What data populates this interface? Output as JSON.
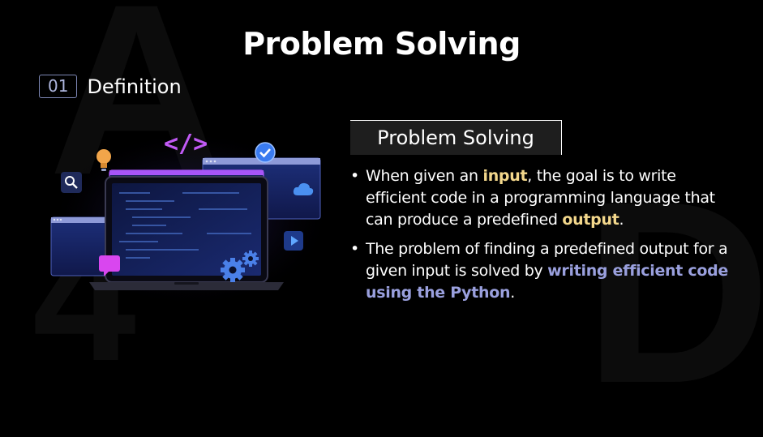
{
  "slide": {
    "title": "Problem Solving",
    "section_number": "01",
    "section_label": "Definition",
    "box_heading": "Problem Solving"
  },
  "bullets": [
    {
      "pre": "When given an ",
      "hl1": "input",
      "mid": ", the goal is to write efficient code in a programming language that can produce a predefined ",
      "hl2": "output",
      "post": "."
    },
    {
      "pre": "The problem of finding a predefined output for a given input is solved by ",
      "hl": "writing efficient code using the Python",
      "post": "."
    }
  ],
  "illustration": {
    "code_tag": "</>",
    "icons": [
      "lightbulb-icon",
      "search-icon",
      "checkmark-icon",
      "cloud-icon",
      "play-icon",
      "gear-icon",
      "chat-icon"
    ]
  },
  "colors": {
    "background": "#000000",
    "highlight_yellow": "#f3d78b",
    "highlight_purple": "#9aa0de",
    "accent_violet": "#a855f7"
  }
}
